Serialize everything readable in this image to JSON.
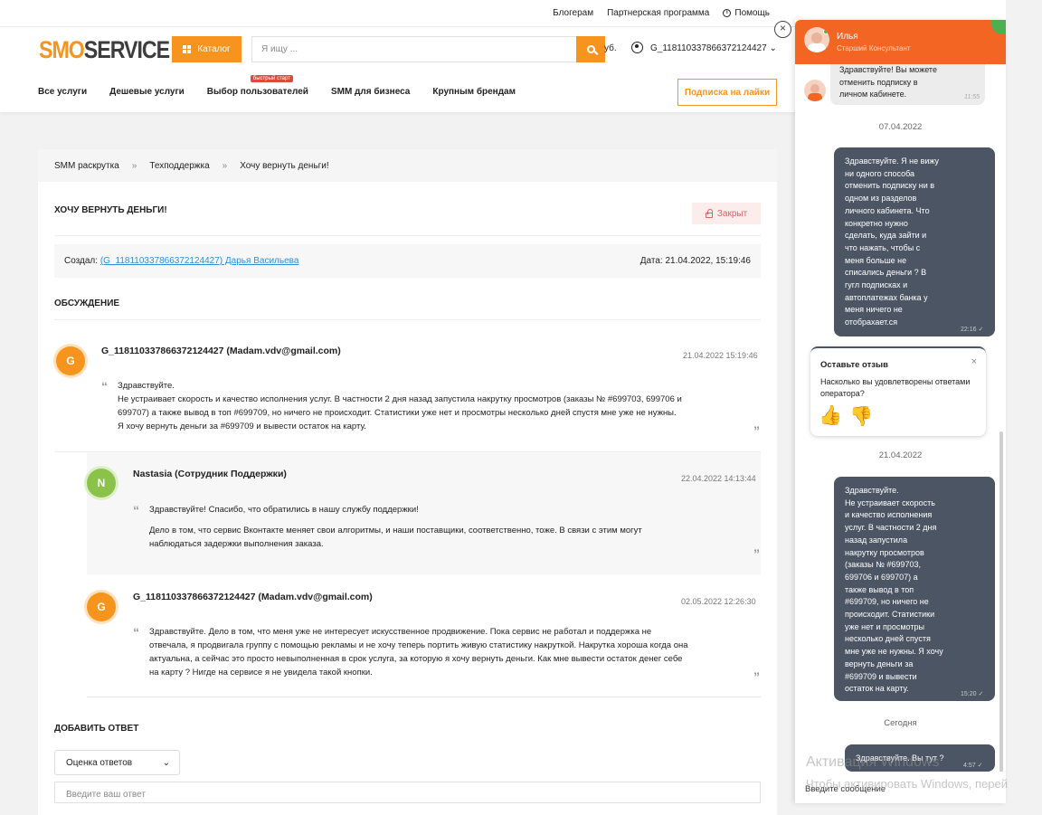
{
  "topbar": {
    "blog": "Блогерам",
    "partner": "Партнерская программа",
    "help": "Помощь"
  },
  "header": {
    "logo_a": "SMO",
    "logo_b": "SERVICE",
    "catalog": "Каталог",
    "search_placeholder": "Я ищу ...",
    "balance": "уб.",
    "username": "G_118110337866372124427",
    "nav": [
      "Все услуги",
      "Дешевые услуги",
      "Выбор пользователей",
      "SMM для бизнеса",
      "Крупным брендам"
    ],
    "nav_badge": "быстрый старт",
    "subscribe": "Подписка на лайки"
  },
  "breadcrumb": [
    "SMM раскрутка",
    "Техподдержка",
    "Хочу вернуть деньги!"
  ],
  "ticket": {
    "title": "ХОЧУ ВЕРНУТЬ ДЕНЬГИ!",
    "status": "Закрыт",
    "created_label": "Создал:",
    "creator": "(G_118110337866372124427) Дарья Васильева",
    "date": "Дата: 21.04.2022, 15:19:46"
  },
  "discussion_title": "ОБСУЖДЕНИЕ",
  "messages": [
    {
      "initial": "G",
      "author": "G_118110337866372124427 (Madam.vdv@gmail.com)",
      "date": "21.04.2022 15:19:46",
      "lines": [
        "Здравствуйте.",
        "Не устраивает скорость и качество исполнения услуг. В частности 2 дня назад запустила накрутку просмотров (заказы № #699703, 699706 и",
        "699707) а также вывод в топ  #699709, но ничего не происходит.  Статистики уже нет и просмотры несколько дней спустя мне уже не нужны.",
        "Я хочу вернуть деньги за #699709 и вывести остаток на карту."
      ]
    },
    {
      "initial": "N",
      "author": "Nastasia (Сотрудник Поддержки)",
      "date": "22.04.2022 14:13:44",
      "lines": [
        "Здравствуйте! Спасибо, что обратились в нашу службу поддержки!",
        "",
        "Дело в том, что сервис Вконтакте меняет свои алгоритмы, и наши поставщики, соответственно, тоже. В связи с этим могут",
        "наблюдаться задержки выполнения заказа."
      ]
    },
    {
      "initial": "G",
      "author": "G_118110337866372124427 (Madam.vdv@gmail.com)",
      "date": "02.05.2022 12:26:30",
      "lines": [
        "Здравствуйте. Дело в том, что меня уже не интересует искусственное продвижение. Пока сервис не работал и поддержка не",
        "отвечала, я продвигала группу с помощью рекламы и не хочу теперь портить живую статистику накруткой. Накрутка хороша когда она",
        "актуальна, а сейчас это просто невыполненная в срок услуга, за которую я хочу вернуть деньги. Как мне вывести остаток денег себе",
        "на карту ? Нигде на сервисе я не увидела такой кнопки."
      ]
    }
  ],
  "add_reply": {
    "title": "ДОБАВИТЬ ОТВЕТ",
    "rating_select": "Оценка ответов",
    "placeholder": "Введите ваш ответ"
  },
  "chat": {
    "operator_name": "Илья",
    "operator_role": "Старший Консультант",
    "msg_in": [
      "Здравствуйте! Вы можете",
      "отменить подписку в",
      "личном кабинете."
    ],
    "msg_in_time": "11:55",
    "date1": "07.04.2022",
    "msg_out1": [
      "Здравствуйте. Я не вижу",
      "ни одного способа",
      "отменить подписку ни в",
      "одном из разделов",
      "личного кабинета. Что",
      "конкретно нужно",
      "сделать, куда зайти и",
      "что нажать, чтобы с",
      "меня больше не",
      "списались деньги ? В",
      "гугл подписках и",
      "автоплатежах банка у",
      "меня ничего не",
      "отобрахает.ся"
    ],
    "msg_out1_time": "22:16 ✓",
    "review_title": "Оставьте отзыв",
    "review_question": "Насколько вы удовлетворены ответами оператора?",
    "date2": "21.04.2022",
    "msg_out2": [
      "Здравствуйте.",
      "Не устраивает скорость",
      "и качество исполнения",
      "услуг. В частности 2 дня",
      "назад запустила",
      "накрутку просмотров",
      "(заказы № #699703,",
      "699706 и 699707) а",
      "также вывод в топ",
      "#699709, но ничего не",
      "происходит. Статистики",
      "уже нет и просмотры",
      "несколько дней спустя",
      "мне уже не нужны. Я хочу",
      "вернуть деньги за",
      "#699709 и вывести",
      "остаток на карту."
    ],
    "msg_out2_time": "15:20 ✓",
    "date3": "Сегодня",
    "msg_out3": "Здравствуйте. Вы тут ?",
    "msg_out3_time": "4:57 ✓",
    "input_placeholder": "Введите сообщение"
  },
  "watermark": {
    "line1": "Активация Windows",
    "line2": "Чтобы активировать Windows, перей"
  }
}
